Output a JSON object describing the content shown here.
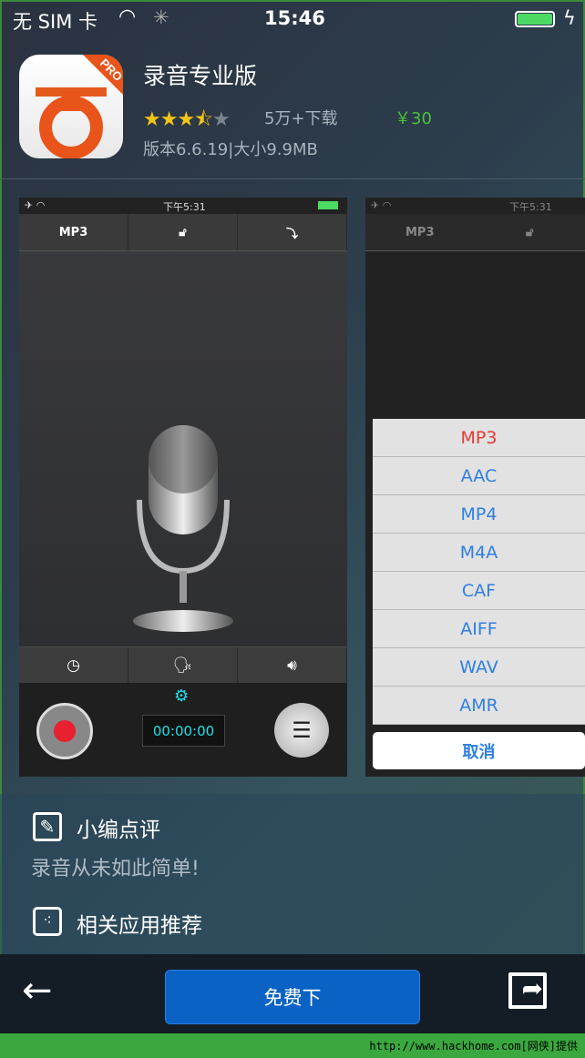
{
  "status": {
    "carrier": "无 SIM 卡",
    "time": "15:46"
  },
  "app": {
    "title": "录音专业版",
    "rating": 3.5,
    "rating_max": 5,
    "downloads": "5万+下载",
    "price": "￥30",
    "version_size": "版本6.6.19|大小9.9MB",
    "badge": "PRO"
  },
  "shot1": {
    "time": "下午5:31",
    "format": "MP3",
    "timer": "00:00:00"
  },
  "shot2": {
    "time": "下午5:31",
    "format": "MP3",
    "options": [
      "MP3",
      "AAC",
      "MP4",
      "M4A",
      "CAF",
      "AIFF",
      "WAV",
      "AMR"
    ],
    "cancel": "取消"
  },
  "review": {
    "heading": "小编点评",
    "text": "录音从未如此简单!",
    "related": "相关应用推荐"
  },
  "bottom": {
    "download": "免费下"
  },
  "watermark": "http://www.hackhome.com[网侠]提供",
  "colors": {
    "price": "#4cc13a",
    "button": "#0a62c4",
    "selected_option": "#e53935",
    "option": "#2f7fe0"
  }
}
